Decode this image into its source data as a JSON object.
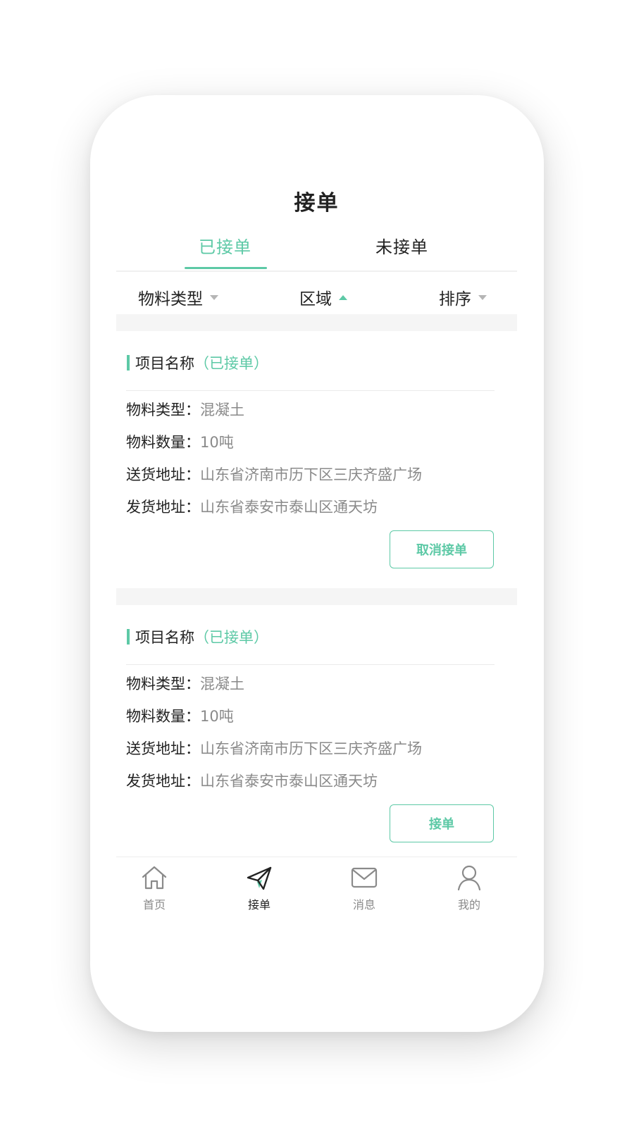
{
  "header": {
    "title": "接单"
  },
  "tabs": [
    {
      "label": "已接单",
      "active": true
    },
    {
      "label": "未接单",
      "active": false
    }
  ],
  "filters": [
    {
      "label": "物料类型",
      "caret": "down"
    },
    {
      "label": "区域",
      "caret": "up"
    },
    {
      "label": "排序",
      "caret": "down"
    }
  ],
  "cards": [
    {
      "title": "项目名称",
      "status": "（已接单）",
      "rows": [
        {
          "label": "物料类型：",
          "value": "混凝土"
        },
        {
          "label": "物料数量：",
          "value": "10吨"
        },
        {
          "label": "送货地址：",
          "value": "山东省济南市历下区三庆齐盛广场"
        },
        {
          "label": "发货地址：",
          "value": "山东省泰安市泰山区通天坊"
        }
      ],
      "action": "取消接单"
    },
    {
      "title": "项目名称",
      "status": "（已接单）",
      "rows": [
        {
          "label": "物料类型：",
          "value": "混凝土"
        },
        {
          "label": "物料数量：",
          "value": "10吨"
        },
        {
          "label": "送货地址：",
          "value": "山东省济南市历下区三庆齐盛广场"
        },
        {
          "label": "发货地址：",
          "value": "山东省泰安市泰山区通天坊"
        }
      ],
      "action": "接单"
    }
  ],
  "tabbar": [
    {
      "label": "首页",
      "icon": "home-icon",
      "current": false
    },
    {
      "label": "接单",
      "icon": "paper-plane-icon",
      "current": true
    },
    {
      "label": "消息",
      "icon": "mail-icon",
      "current": false
    },
    {
      "label": "我的",
      "icon": "user-icon",
      "current": false
    }
  ],
  "colors": {
    "accent": "#5dc9a6",
    "text": "#222222",
    "muted": "#8a8a8a",
    "band": "#f5f5f5"
  }
}
